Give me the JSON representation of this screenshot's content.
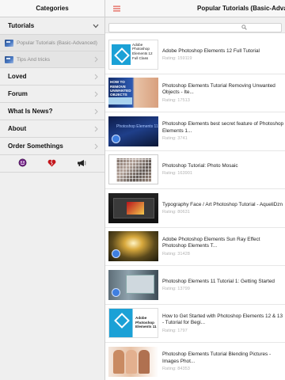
{
  "sidebar": {
    "header": "Categories",
    "tutorials": {
      "label": "Tutorials"
    },
    "subitems": [
      {
        "label": "Popular Tutorials (Basic-Advanced)"
      },
      {
        "label": "Tips And tricks"
      }
    ],
    "items": [
      {
        "label": "Loved"
      },
      {
        "label": "Forum"
      },
      {
        "label": "What Is News?"
      },
      {
        "label": "About"
      },
      {
        "label": "Order Somethings"
      }
    ],
    "bottom_icons": [
      "smiley-icon",
      "broken-heart-icon",
      "megaphone-icon"
    ]
  },
  "header": {
    "title": "Popular Tutorials (Basic-Advanced)"
  },
  "search": {
    "placeholder": ""
  },
  "list": [
    {
      "title": "Adobe Photoshop Elements 12 Full Tutorial",
      "rating": "Rating: 159119",
      "thumb_text": "Adobe Photoshop Elements 12 Full Class"
    },
    {
      "title": "Photoshop Elements Tutorial Removing Unwanted Objects - Ite...",
      "rating": "Rating: 17513",
      "thumb_text": "HOW TO REMOVE UNWANTED OBJECTS"
    },
    {
      "title": "Photoshop Elements best secret feature of Photoshop Elements 1...",
      "rating": "Rating: 3741",
      "thumb_text": "Photoshop Elements 11"
    },
    {
      "title": "Photoshop Tutorial: Photo Mosaic",
      "rating": "Rating: 163901"
    },
    {
      "title": "Typography Face / Art Photoshop Tutorial - AqueliDzn",
      "rating": "Rating: 80631"
    },
    {
      "title": "Adobe Photoshop Elements Sun Ray Effect Photoshop Elements T...",
      "rating": "Rating: 31428"
    },
    {
      "title": "Photoshop Elements 11 Tutorial 1: Getting Started",
      "rating": "Rating: 13799"
    },
    {
      "title": "How to Get Started with Photoshop Elements 12 & 13 - Tutorial for Begi...",
      "rating": "Rating: 1797",
      "thumb_text": "Adobe Photoshop Elements 11"
    },
    {
      "title": "Photoshop Elements Tutorial Blending Pictures - Images Phot...",
      "rating": "Rating: 84353"
    }
  ],
  "colors": {
    "accent": "#e0463a",
    "panel_bg": "#efefef",
    "rating_gray": "#b3b3b3",
    "brand_blue": "#1ba1d6"
  }
}
